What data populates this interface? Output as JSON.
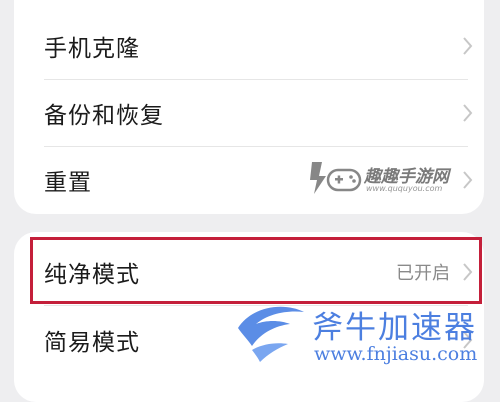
{
  "settings": {
    "group1": [
      {
        "label": "手机克隆",
        "value": ""
      },
      {
        "label": "备份和恢复",
        "value": ""
      },
      {
        "label": "重置",
        "value": ""
      }
    ],
    "group2": [
      {
        "label": "纯净模式",
        "value": "已开启"
      },
      {
        "label": "简易模式",
        "value": ""
      }
    ]
  },
  "highlight_color": "#c41f3a",
  "watermarks": {
    "site1_name": "趣趣手游网",
    "site1_url": "www.ququyou.com",
    "site2_name": "斧牛加速器",
    "site2_url": "www.fnjiasu.com"
  }
}
